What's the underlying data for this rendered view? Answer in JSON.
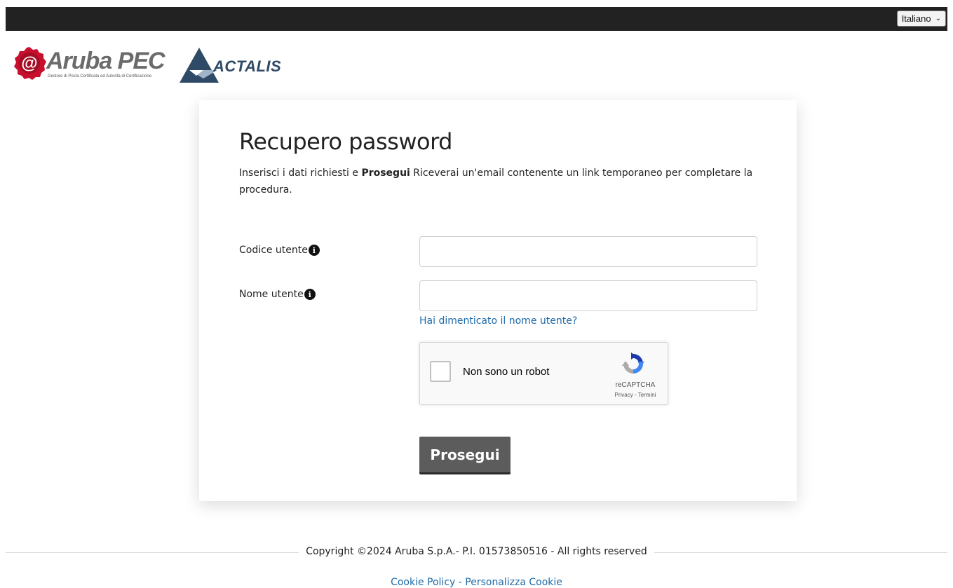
{
  "topbar": {
    "language_label": "Italiano"
  },
  "logos": {
    "aruba_name": "Aruba PEC",
    "aruba_tagline": "Gestore di Posta Certificata ed Autorità di Certificazione",
    "actalis_name": "ACTALIS"
  },
  "form": {
    "title": "Recupero password",
    "intro_before": "Inserisci i dati richiesti e ",
    "intro_bold": "Prosegui",
    "intro_after": " Riceverai un'email contenente un link temporaneo per completare la procedura.",
    "fields": [
      {
        "label": "Codice utente",
        "value": ""
      },
      {
        "label": "Nome utente",
        "value": ""
      }
    ],
    "forgot_username_link": "Hai dimenticato il nome utente?",
    "submit_label": "Prosegui"
  },
  "recaptcha": {
    "label": "Non sono un robot",
    "brand": "reCAPTCHA",
    "privacy_link": "Privacy",
    "separator": " - ",
    "terms_link": "Termini"
  },
  "footer": {
    "copyright": "Copyright ©2024 Aruba S.p.A.- P.I. 01573850516 - All rights reserved",
    "cookie_policy": "Cookie Policy",
    "link_separator": " - ",
    "customize_cookie": "Personalizza Cookie"
  },
  "colors": {
    "topbar_bg": "#222222",
    "link": "#1e6aa8",
    "button_bg": "#5c5c5c",
    "aruba_red": "#c8102e",
    "actalis_blue": "#2e4a66"
  },
  "icons": [
    "chevron-down-icon",
    "info-icon",
    "recaptcha-logo-icon"
  ]
}
